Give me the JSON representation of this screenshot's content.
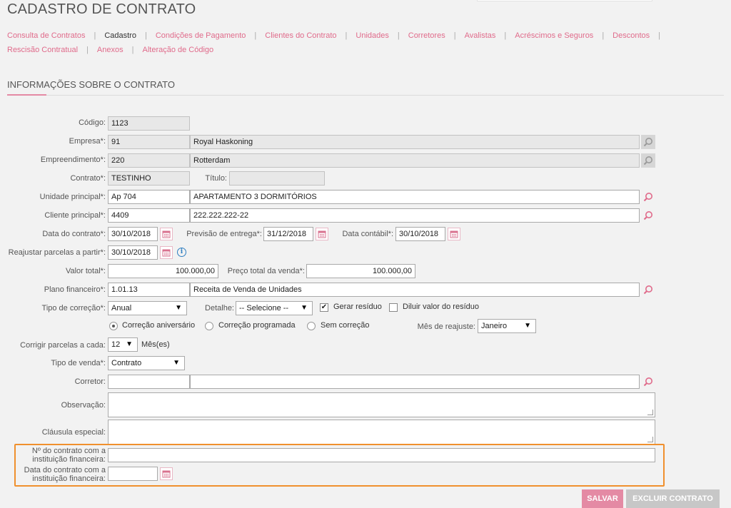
{
  "page": {
    "title": "CADASTRO DE CONTRATO"
  },
  "nav": {
    "row1": [
      "Consulta de Contratos",
      "Cadastro",
      "Condições de Pagamento",
      "Clientes do Contrato",
      "Unidades",
      "Corretores",
      "Avalistas",
      "Acréscimos e Seguros",
      "Descontos"
    ],
    "row2": [
      "Rescisão Contratual",
      "Anexos",
      "Alteração de Código"
    ],
    "active": "Cadastro"
  },
  "section": {
    "title": "INFORMAÇÕES SOBRE O CONTRATO"
  },
  "form": {
    "codigo": {
      "label": "Código:",
      "value": "1123"
    },
    "empresa": {
      "label": "Empresa*:",
      "code": "91",
      "name": "Royal Haskoning"
    },
    "empreendimento": {
      "label": "Empreendimento*:",
      "code": "220",
      "name": "Rotterdam"
    },
    "contrato": {
      "label": "Contrato*:",
      "value": "TESTINHO"
    },
    "titulo": {
      "label": "Título:",
      "value": ""
    },
    "unidade": {
      "label": "Unidade principal*:",
      "code": "Ap 704",
      "name": "APARTAMENTO 3 DORMITÓRIOS"
    },
    "cliente": {
      "label": "Cliente principal*:",
      "code": "4409",
      "name": "222.222.222-22"
    },
    "data_contrato": {
      "label": "Data do contrato*:",
      "value": "30/10/2018"
    },
    "previsao_entrega": {
      "label": "Previsão de entrega*:",
      "value": "31/12/2018"
    },
    "data_contabil": {
      "label": "Data contábil*:",
      "value": "30/10/2018"
    },
    "reajustar": {
      "label": "Reajustar parcelas a partir*:",
      "value": "30/10/2018"
    },
    "valor_total": {
      "label": "Valor total*:",
      "value": "100.000,00"
    },
    "preco_total": {
      "label": "Preço total da venda*:",
      "value": "100.000,00"
    },
    "plano": {
      "label": "Plano financeiro*:",
      "code": "1.01.13",
      "name": "Receita de Venda de Unidades"
    },
    "tipo_correcao": {
      "label": "Tipo de correção*:",
      "value": "Anual"
    },
    "detalhe": {
      "label": "Detalhe:",
      "value": "-- Selecione --"
    },
    "gerar_residuo": {
      "label": "Gerar resíduo",
      "checked": true
    },
    "diluir": {
      "label": "Diluir valor do resíduo",
      "checked": false
    },
    "correcao_options": [
      "Correção aniversário",
      "Correção programada",
      "Sem correção"
    ],
    "correcao_selected": 0,
    "mes_reajuste": {
      "label": "Mês de reajuste:",
      "value": "Janeiro"
    },
    "corrigir": {
      "label": "Corrigir parcelas a cada:",
      "value": "12",
      "unit": "Mês(es)"
    },
    "tipo_venda": {
      "label": "Tipo de venda*:",
      "value": "Contrato"
    },
    "corretor": {
      "label": "Corretor:",
      "code": "",
      "name": ""
    },
    "observacao": {
      "label": "Observação:",
      "value": ""
    },
    "clausula": {
      "label": "Cláusula especial:",
      "value": ""
    },
    "numero_inst": {
      "label": "Nº do contrato com a instituição financeira:",
      "value": ""
    },
    "data_inst": {
      "label": "Data do contrato com a instituição financeira:",
      "value": ""
    }
  },
  "buttons": {
    "save": "SALVAR",
    "delete": "EXCLUIR CONTRATO"
  },
  "colors": {
    "accent": "#e48aa4",
    "link": "#e06b8b",
    "highlight": "#f0902e"
  }
}
